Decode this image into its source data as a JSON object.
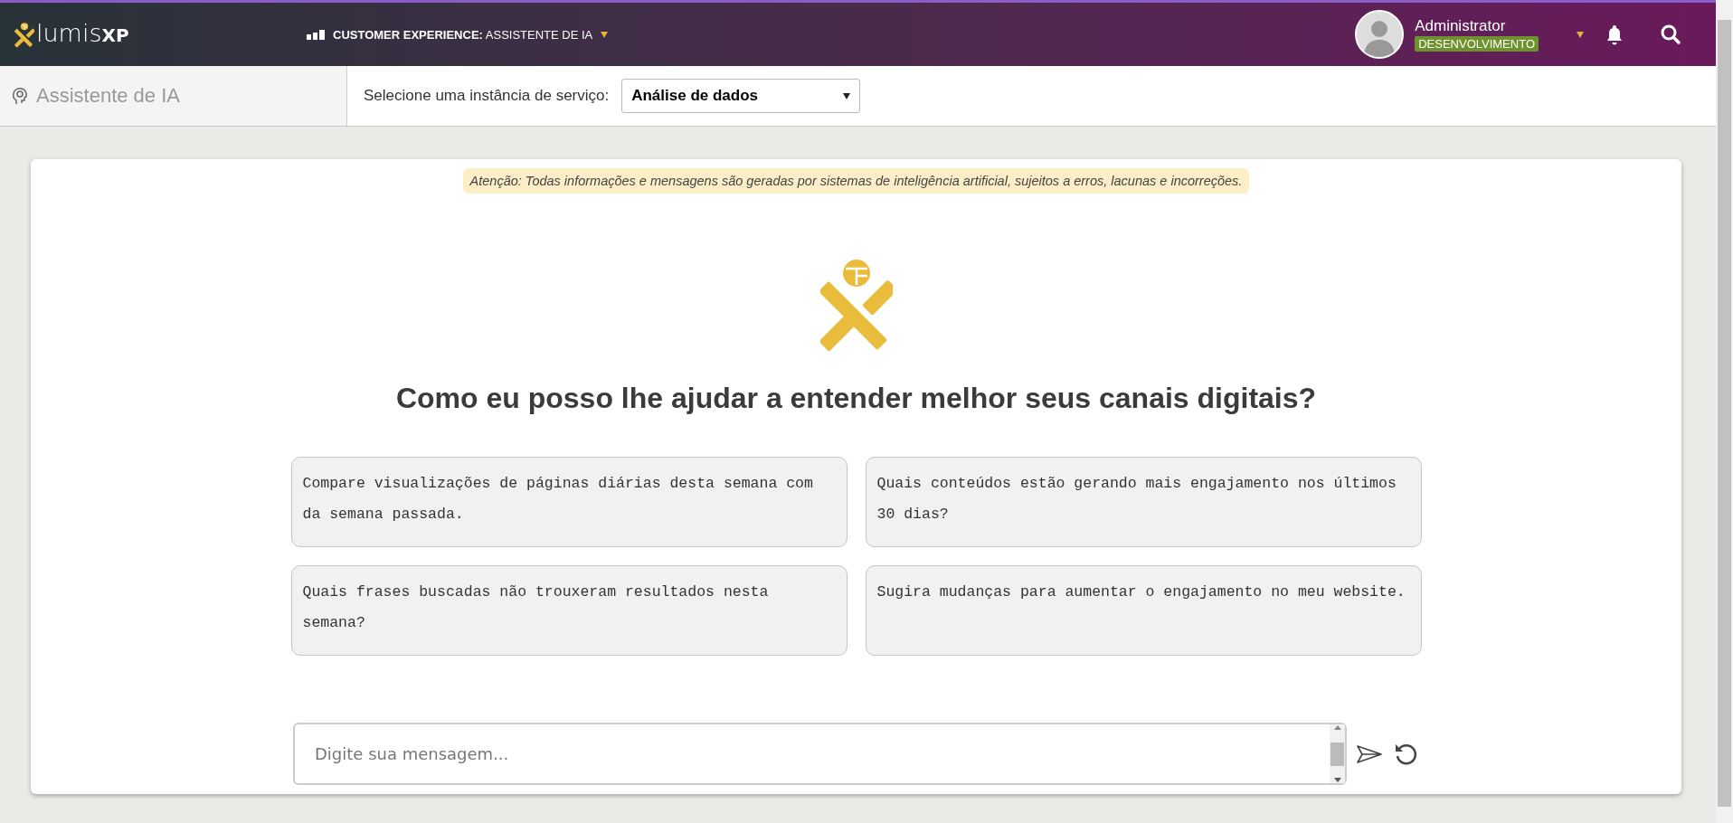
{
  "header": {
    "logo": {
      "text": "lumis",
      "suffix": "XP"
    },
    "context": {
      "label": "CUSTOMER EXPERIENCE:",
      "value": "ASSISTENTE DE IA"
    },
    "user": {
      "name": "Administrator",
      "environment": "DESENVOLVIMENTO"
    }
  },
  "subheader": {
    "title": "Assistente de IA",
    "instance_label": "Selecione uma instância de serviço:",
    "instance_select": {
      "value": "Análise de dados"
    }
  },
  "chat": {
    "notice": "Atenção: Todas informações e mensagens são geradas por sistemas de inteligência artificial, sujeitos a erros, lacunas e incorreções.",
    "heading": "Como eu posso lhe ajudar a entender melhor seus canais digitais?",
    "suggestions": [
      "Compare visualizações de páginas diárias desta semana com da semana passada.",
      "Quais conteúdos estão gerando mais engajamento nos últimos 30 dias?",
      "Quais frases buscadas não trouxeram resultados nesta semana?",
      "Sugira mudanças para aumentar o engajamento no meu website."
    ],
    "input": {
      "placeholder": "Digite sua mensagem..."
    }
  }
}
